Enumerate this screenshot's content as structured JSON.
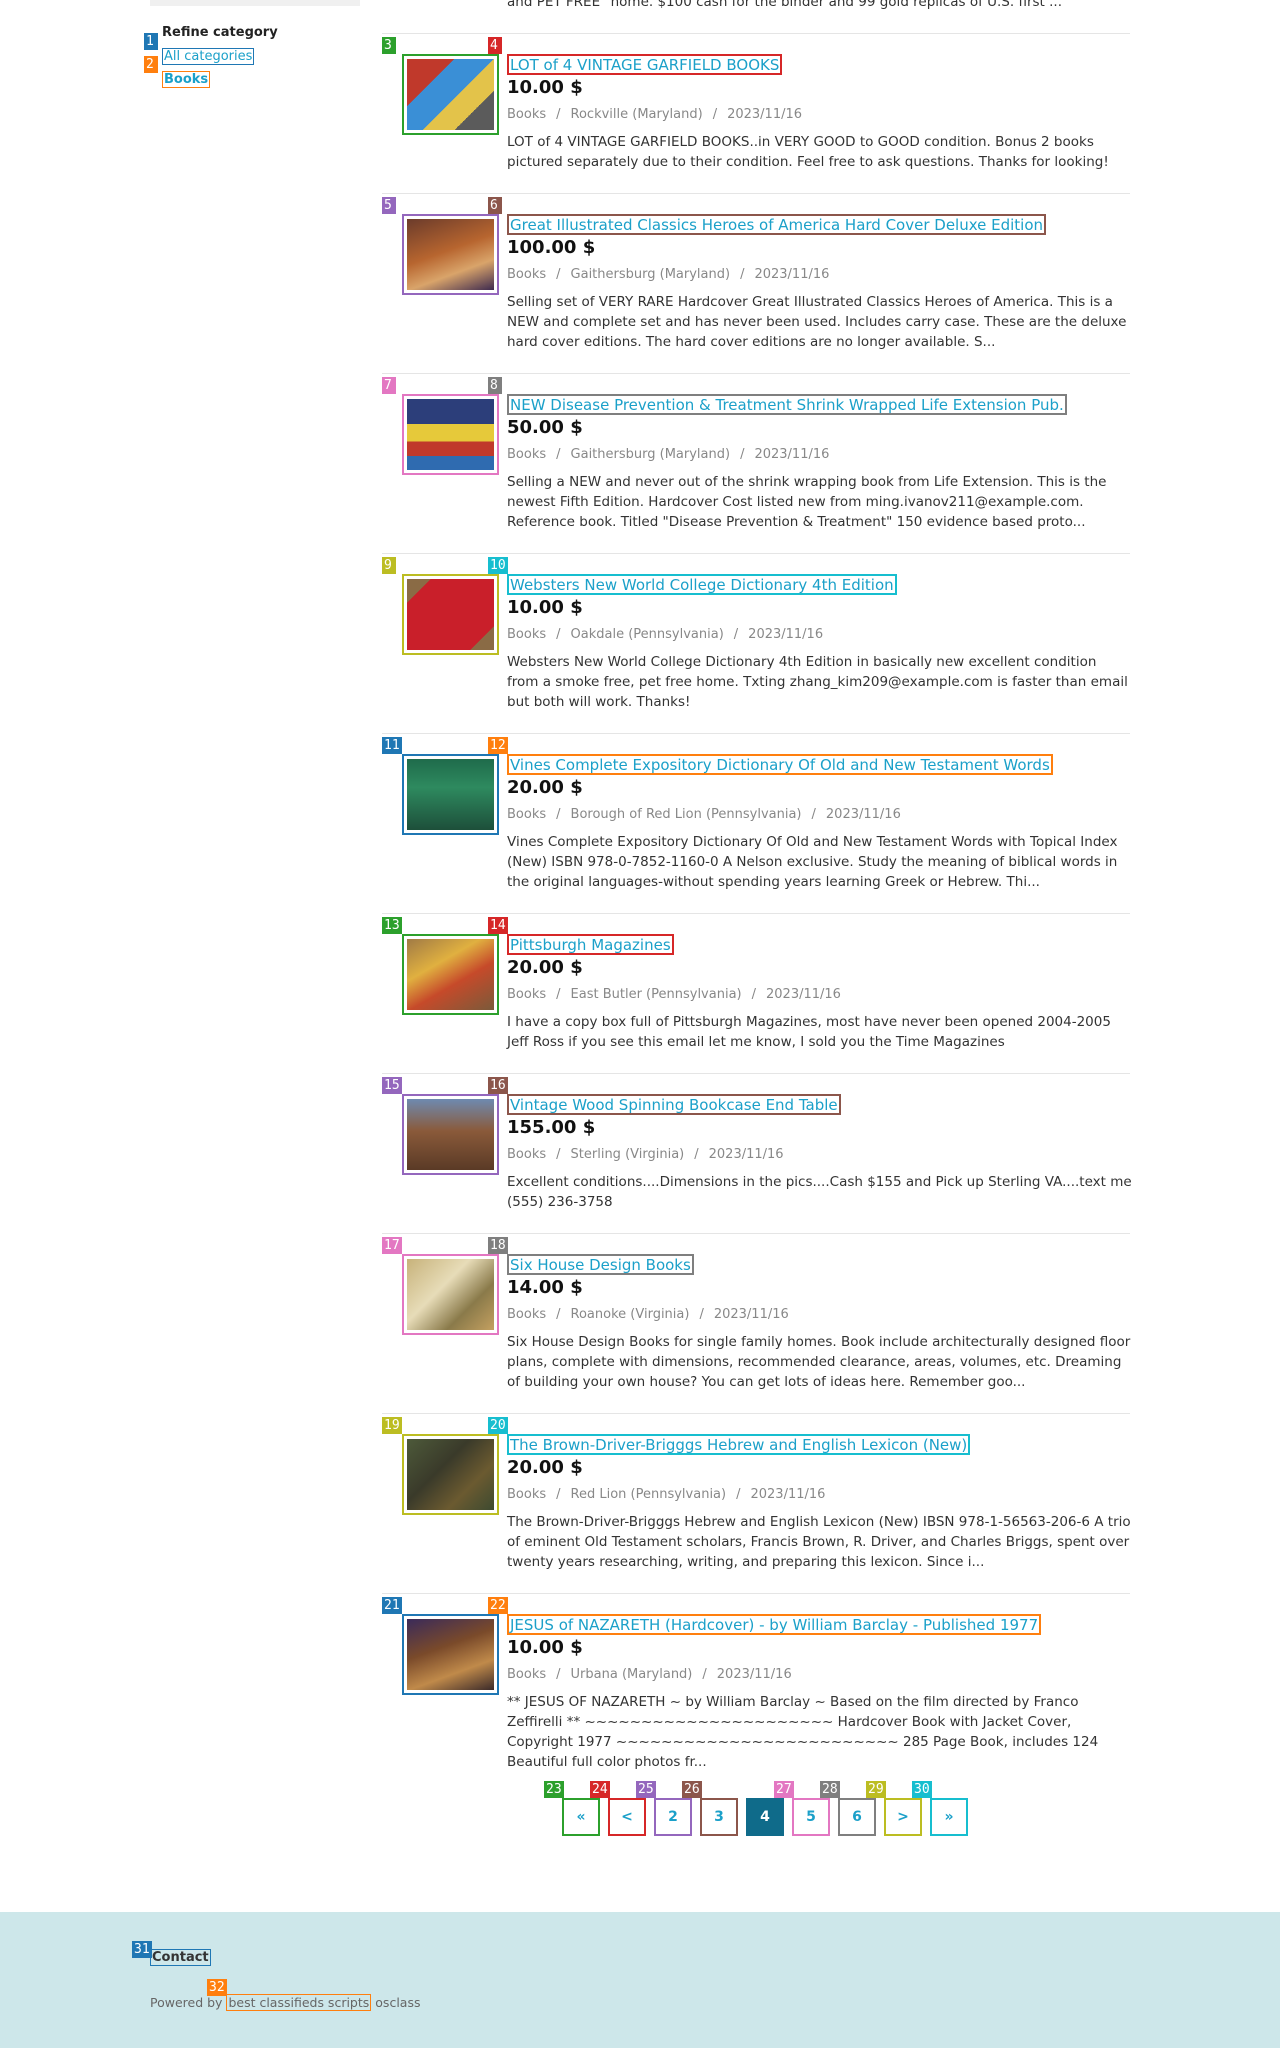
{
  "colors": {
    "link": "#1ba0c9",
    "active_page": "#0f6b8a",
    "footer_bg": "#cde7ea",
    "markers": [
      "#1f77b4",
      "#ff7f0e",
      "#2ca02c",
      "#d62728",
      "#9467bd",
      "#8c564b",
      "#e377c2",
      "#7f7f7f",
      "#bcbd22",
      "#17becf"
    ]
  },
  "top_fragment": "and PET FREE\" home. $100 cash for the binder and 99 gold replicas of U.S. first ...",
  "sidebar": {
    "title": "Refine category",
    "links": [
      {
        "label": "All categories",
        "marker": "1"
      },
      {
        "label": "Books",
        "marker": "2"
      }
    ]
  },
  "listings": [
    {
      "img_marker": "3",
      "title_marker": "4",
      "title": "LOT of 4 VINTAGE GARFIELD BOOKS",
      "price": "10.00 $",
      "category": "Books",
      "location": "Rockville (Maryland)",
      "date": "2023/11/16",
      "desc": "LOT of 4 VINTAGE GARFIELD BOOKS..in VERY GOOD to GOOD condition. Bonus 2 books pictured separately due to their condition. Feel free to ask questions. Thanks for looking!"
    },
    {
      "img_marker": "5",
      "title_marker": "6",
      "title": "Great Illustrated Classics Heroes of America Hard Cover Deluxe Edition",
      "price": "100.00 $",
      "category": "Books",
      "location": "Gaithersburg (Maryland)",
      "date": "2023/11/16",
      "desc": "Selling set of VERY RARE Hardcover Great Illustrated Classics Heroes of America. This is a NEW and complete set and has never been used. Includes carry case. These are the deluxe hard cover editions. The hard cover editions are no longer available. S..."
    },
    {
      "img_marker": "7",
      "title_marker": "8",
      "title": "NEW Disease Prevention & Treatment Shrink Wrapped Life Extension Pub.",
      "price": "50.00 $",
      "category": "Books",
      "location": "Gaithersburg (Maryland)",
      "date": "2023/11/16",
      "desc": "Selling a NEW and never out of the shrink wrapping book from Life Extension. This is the newest Fifth Edition. Hardcover Cost listed new from ming.ivanov211@example.com. Reference book. Titled \"Disease Prevention & Treatment\" 150 evidence based proto..."
    },
    {
      "img_marker": "9",
      "title_marker": "10",
      "title": "Websters New World College Dictionary 4th Edition",
      "price": "10.00 $",
      "category": "Books",
      "location": "Oakdale (Pennsylvania)",
      "date": "2023/11/16",
      "desc": "Websters New World College Dictionary 4th Edition in basically new excellent condition from a smoke free, pet free home. Txting zhang_kim209@example.com is faster than email but both will work. Thanks!"
    },
    {
      "img_marker": "11",
      "title_marker": "12",
      "title": "Vines Complete Expository Dictionary Of Old and New Testament Words",
      "price": "20.00 $",
      "category": "Books",
      "location": "Borough of Red Lion (Pennsylvania)",
      "date": "2023/11/16",
      "desc": "Vines Complete Expository Dictionary Of Old and New Testament Words with Topical Index (New) ISBN 978-0-7852-1160-0 A Nelson exclusive. Study the meaning of biblical words in the original languages-without spending years learning Greek or Hebrew. Thi..."
    },
    {
      "img_marker": "13",
      "title_marker": "14",
      "title": "Pittsburgh Magazines",
      "price": "20.00 $",
      "category": "Books",
      "location": "East Butler (Pennsylvania)",
      "date": "2023/11/16",
      "desc": "I have a copy box full of Pittsburgh Magazines, most have never been opened 2004-2005 Jeff Ross if you see this email let me know, I sold you the Time Magazines"
    },
    {
      "img_marker": "15",
      "title_marker": "16",
      "title": "Vintage Wood Spinning Bookcase End Table",
      "price": "155.00 $",
      "category": "Books",
      "location": "Sterling (Virginia)",
      "date": "2023/11/16",
      "desc": "Excellent conditions....Dimensions in the pics....Cash $155 and Pick up Sterling VA....text me (555) 236-3758"
    },
    {
      "img_marker": "17",
      "title_marker": "18",
      "title": "Six House Design Books",
      "price": "14.00 $",
      "category": "Books",
      "location": "Roanoke (Virginia)",
      "date": "2023/11/16",
      "desc": "Six House Design Books for single family homes. Book include architecturally designed floor plans, complete with dimensions, recommended clearance, areas, volumes, etc. Dreaming of building your own house? You can get lots of ideas here. Remember goo..."
    },
    {
      "img_marker": "19",
      "title_marker": "20",
      "title": "The Brown-Driver-Brigggs Hebrew and English Lexicon (New)",
      "price": "20.00 $",
      "category": "Books",
      "location": "Red Lion (Pennsylvania)",
      "date": "2023/11/16",
      "desc": "The Brown-Driver-Brigggs Hebrew and English Lexicon (New) IBSN 978-1-56563-206-6 A trio of eminent Old Testament scholars, Francis Brown, R. Driver, and Charles Briggs, spent over twenty years researching, writing, and preparing this lexicon. Since i..."
    },
    {
      "img_marker": "21",
      "title_marker": "22",
      "title": "JESUS of NAZARETH (Hardcover) - by William Barclay - Published 1977",
      "price": "10.00 $",
      "category": "Books",
      "location": "Urbana (Maryland)",
      "date": "2023/11/16",
      "desc": "** JESUS OF NAZARETH ~ by William Barclay ~ Based on the film directed by Franco Zeffirelli ** ~~~~~~~~~~~~~~~~~~~~~~ Hardcover Book with Jacket Cover, Copyright 1977 ~~~~~~~~~~~~~~~~~~~~~~~~~ 285 Page Book, includes 124 Beautiful full color photos fr..."
    }
  ],
  "pagination": [
    {
      "label": "«",
      "marker": "23",
      "active": false
    },
    {
      "label": "<",
      "marker": "24",
      "active": false
    },
    {
      "label": "2",
      "marker": "25",
      "active": false
    },
    {
      "label": "3",
      "marker": "26",
      "active": false
    },
    {
      "label": "4",
      "marker": "",
      "active": true
    },
    {
      "label": "5",
      "marker": "27",
      "active": false
    },
    {
      "label": "6",
      "marker": "28",
      "active": false
    },
    {
      "label": ">",
      "marker": "29",
      "active": false
    },
    {
      "label": "»",
      "marker": "30",
      "active": false
    }
  ],
  "footer": {
    "contact": "Contact",
    "contact_marker": "31",
    "powered_prefix": "Powered by",
    "powered_link": "best classifieds scripts",
    "powered_link_marker": "32",
    "powered_suffix": "osclass"
  }
}
